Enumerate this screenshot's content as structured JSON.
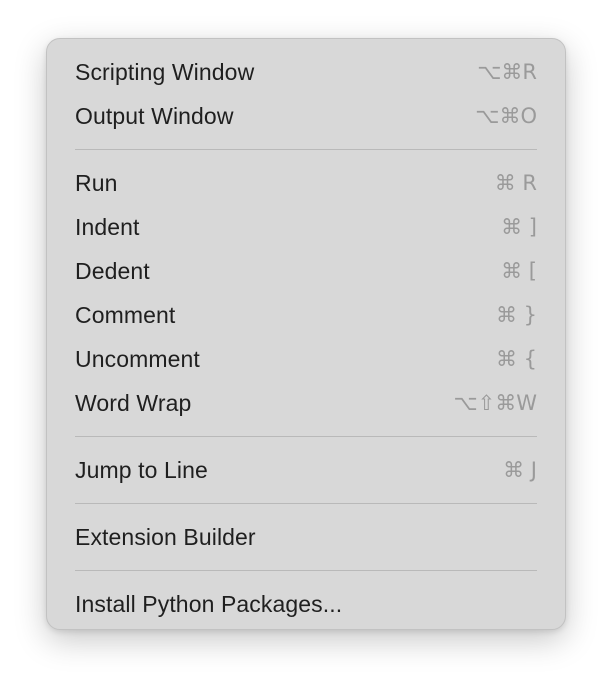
{
  "menu": {
    "items": [
      {
        "label": "Scripting Window",
        "shortcut": "⌥⌘R"
      },
      {
        "label": "Output Window",
        "shortcut": "⌥⌘O"
      },
      {
        "label": "Run",
        "shortcut": "⌘ R"
      },
      {
        "label": "Indent",
        "shortcut": "⌘ ]"
      },
      {
        "label": "Dedent",
        "shortcut": "⌘ ["
      },
      {
        "label": "Comment",
        "shortcut": "⌘ }"
      },
      {
        "label": "Uncomment",
        "shortcut": "⌘ {"
      },
      {
        "label": "Word Wrap",
        "shortcut": "⌥⇧⌘W"
      },
      {
        "label": "Jump to Line",
        "shortcut": "⌘ J"
      },
      {
        "label": "Extension Builder",
        "shortcut": ""
      },
      {
        "label": "Install Python Packages...",
        "shortcut": ""
      }
    ]
  },
  "colors": {
    "menu_background": "#d8d8d8",
    "label_text": "#1f1f1f",
    "shortcut_text": "#9a9a9a",
    "separator": "#b9b9b9"
  }
}
